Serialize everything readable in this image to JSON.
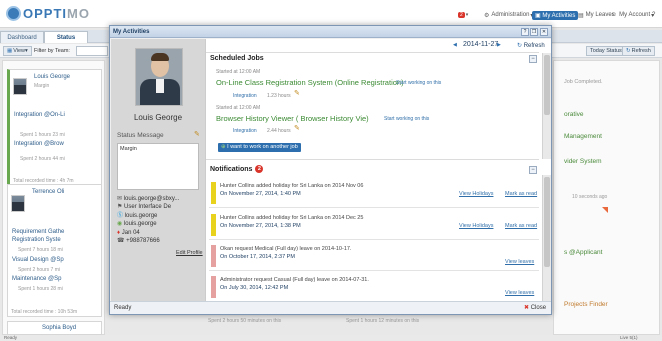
{
  "app": {
    "logo_prefix": "OPPTI",
    "logo_suffix": "MO"
  },
  "topnav": {
    "badge": "2",
    "administration": "Administration",
    "my_activities": "My Activities",
    "my_leaves": "My Leaves",
    "my_account": "My Account",
    "help": "?"
  },
  "tabs": [
    "Dashboard",
    "Status"
  ],
  "toolbar": {
    "view": "View",
    "filter": "Filter by Team:",
    "today_status": "Today Status",
    "refresh": "Refresh"
  },
  "background": {
    "col1": {
      "card1": {
        "name": "Louis George",
        "sub": "Margin",
        "items": [
          "Integration @On-Li",
          "Spent 1 hours 23 mi",
          "Integration @Brow",
          "Spent 2 hours 44 mi"
        ],
        "total": "Total recorded time : 4h 7m"
      },
      "card2": {
        "name": "Terrence Oli",
        "items": [
          "Requirement Gathe",
          "Registration Syste",
          "Spent 7 hours 18 mi",
          "Visual Design @Sp",
          "Spent 2 hours 7 mi",
          "Maintenance @Sp",
          "Spent 1 hours 28 mi"
        ],
        "total": "Total recorded time : 10h 53m"
      },
      "card3": {
        "name": "Sophia Boyd"
      }
    },
    "col4": {
      "lines": [
        "Job Completed.",
        "orative",
        "Management",
        "vider System",
        "10 seconds ago",
        "s @Applicant",
        "Projects Finder"
      ]
    },
    "spent_footer": [
      "Spent 2 hours 50 minutes on this",
      "Spent 1 hours 12 minutes on this"
    ]
  },
  "modal": {
    "title": "My Activities",
    "profile": {
      "name": "Louis George",
      "status_label": "Status Message",
      "status_text": "Margin",
      "email": "louis.george@sbxy...",
      "role": "User Interface De",
      "skype": "louis.george",
      "gtalk": "louis.george",
      "birthday": "Jan 04",
      "phone": "+988787666",
      "edit": "Edit Profile"
    },
    "date": "2014-11-27",
    "refresh": "Refresh",
    "scheduled_jobs": {
      "heading": "Scheduled Jobs",
      "jobs": [
        {
          "started": "Started at 12:00 AM",
          "title": "On-Line Class Registration System (Online Registration)",
          "action": "Start working on this",
          "task": "Integration",
          "duration": "1.23 hours"
        },
        {
          "started": "Started at 12:00 AM",
          "title": "Browser History Viewer ( Browser History Vie)",
          "action": "Start working on this",
          "task": "Integration",
          "duration": "2.44 hours"
        }
      ],
      "another_job": "I want to work on another job"
    },
    "notifications": {
      "heading": "Notifications",
      "count": "2",
      "items": [
        {
          "text": "Hunter Collins added holiday for Sri Lanka on 2014 Nov 06",
          "date": "On November 27, 2014, 1:40 PM",
          "links": [
            "View Holidays",
            "Mark as read"
          ],
          "color": "#e8d21d"
        },
        {
          "text": "Hunter Collins added holiday for Sri Lanka on 2014 Dec 25",
          "date": "On November 27, 2014, 1:38 PM",
          "links": [
            "View Holidays",
            "Mark as read"
          ],
          "color": "#e8d21d"
        },
        {
          "text": "Okan request Medical (Full day) leave on 2014-10-17.",
          "date": "On October 17, 2014, 2:37 PM",
          "links": [
            "View leaves"
          ],
          "color": "#e5a0a0"
        },
        {
          "text": "Administrator request Casual (Full day) leave on 2014-07-31.",
          "date": "On July 30, 2014, 12:42 PM",
          "links": [
            "View leaves"
          ],
          "color": "#e5a0a0"
        }
      ]
    },
    "footer": {
      "status": "Ready",
      "close": "Close"
    }
  },
  "statusbar": {
    "left": "Ready",
    "right": "Live 5(1)"
  }
}
